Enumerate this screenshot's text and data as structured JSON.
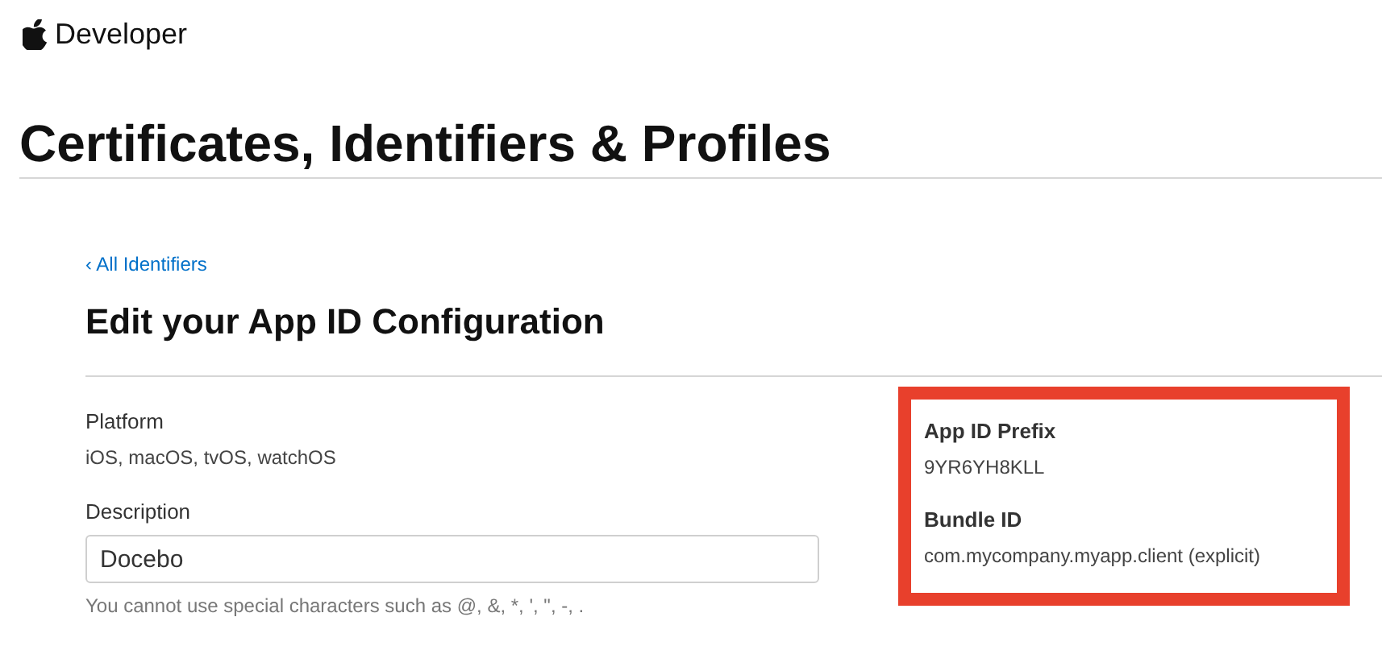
{
  "header": {
    "brand": "Developer"
  },
  "page_title": "Certificates, Identifiers & Profiles",
  "back_link": "‹ All Identifiers",
  "heading": "Edit your App ID Configuration",
  "platform": {
    "label": "Platform",
    "value": "iOS, macOS, tvOS, watchOS"
  },
  "description": {
    "label": "Description",
    "value": "Docebo",
    "hint": "You cannot use special characters such as @, &, *, ', \", -, ."
  },
  "id_panel": {
    "highlighted": true,
    "fields": [
      {
        "label": "App ID Prefix",
        "value": "9YR6YH8KLL"
      },
      {
        "label": "Bundle ID",
        "value": "com.mycompany.myapp.client (explicit)"
      }
    ]
  }
}
